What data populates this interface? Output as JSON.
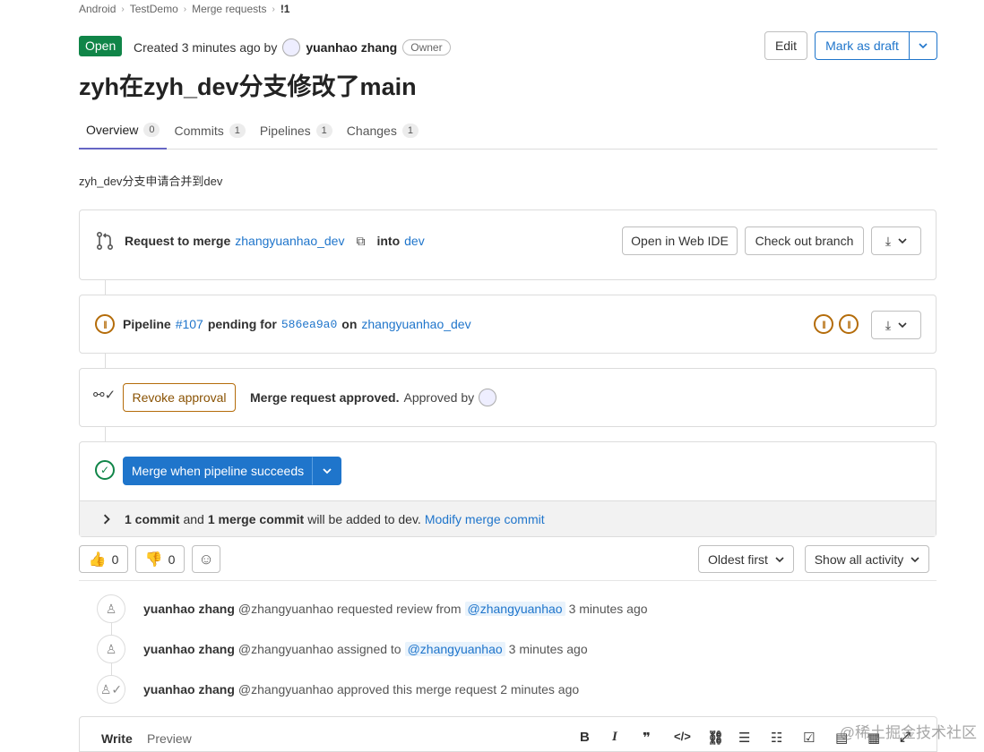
{
  "breadcrumb": [
    "Android",
    "TestDemo",
    "Merge requests",
    "!1"
  ],
  "header": {
    "status": "Open",
    "created_prefix": "Created 3 minutes ago by",
    "author": "yuanhao zhang",
    "role": "Owner",
    "edit_label": "Edit",
    "draft_label": "Mark as draft",
    "title": "zyh在zyh_dev分支修改了main"
  },
  "tabs": [
    {
      "label": "Overview",
      "count": "0"
    },
    {
      "label": "Commits",
      "count": "1"
    },
    {
      "label": "Pipelines",
      "count": "1"
    },
    {
      "label": "Changes",
      "count": "1"
    }
  ],
  "description": "zyh_dev分支申请合并到dev",
  "request": {
    "prefix": "Request to merge",
    "source": "zhangyuanhao_dev",
    "into": "into",
    "target": "dev",
    "web_ide": "Open in Web IDE",
    "checkout": "Check out branch"
  },
  "pipeline": {
    "label": "Pipeline",
    "id": "#107",
    "pending_for": "pending for",
    "sha": "586ea9a0",
    "on": "on",
    "branch": "zhangyuanhao_dev"
  },
  "approval": {
    "revoke": "Revoke approval",
    "approved": "Merge request approved.",
    "approved_by": "Approved by"
  },
  "merge": {
    "button": "Merge when pipeline succeeds",
    "commits_n": "1 commit",
    "and": "and",
    "merge_commits_n": "1 merge commit",
    "added_to": "will be added to dev.",
    "modify": "Modify merge commit"
  },
  "reactions": {
    "thumbs_up": "0",
    "thumbs_down": "0"
  },
  "sort": {
    "order": "Oldest first",
    "filter": "Show all activity"
  },
  "activity": [
    {
      "name": "yuanhao zhang",
      "handle": "@zhangyuanhao",
      "action": "requested review from",
      "mention": "@zhangyuanhao",
      "time": "3 minutes ago"
    },
    {
      "name": "yuanhao zhang",
      "handle": "@zhangyuanhao",
      "action": "assigned to",
      "mention": "@zhangyuanhao",
      "time": "3 minutes ago"
    },
    {
      "name": "yuanhao zhang",
      "handle": "@zhangyuanhao",
      "action": "approved this merge request",
      "mention": "",
      "time": "2 minutes ago"
    }
  ],
  "editor": {
    "write": "Write",
    "preview": "Preview"
  },
  "watermark": "@稀土掘金技术社区",
  "colors": {
    "open": "#108548",
    "link": "#1f75cb",
    "warning": "#b46c0a",
    "primary": "#1f75cb"
  }
}
